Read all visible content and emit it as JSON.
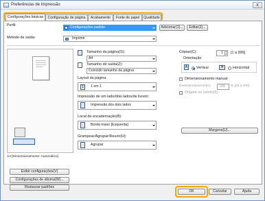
{
  "window": {
    "title": "Preferências de Impressão",
    "close_glyph": "x"
  },
  "tabs": [
    {
      "label": "Configurações básicas",
      "active": true
    },
    {
      "label": "Configuração de página",
      "active": false
    },
    {
      "label": "Acabamento",
      "active": false
    },
    {
      "label": "Fonte de papel",
      "active": false
    },
    {
      "label": "Qualidade",
      "active": false
    }
  ],
  "profile": {
    "label": "Perfil:",
    "value": "Configurações padrão",
    "add_button": "Adicionar(1)...",
    "edit_button": "Editar(2)..."
  },
  "output_method": {
    "label": "Método de saída:",
    "value": "Imprimir"
  },
  "preview": {
    "caption": "A4 [Dimensionamento: Automático]"
  },
  "left_buttons": {
    "display_settings": "Exibir configurações(V)",
    "language_settings": "Configurações de idioma(W)...",
    "restore_defaults": "Restaurar padrões"
  },
  "page_size": {
    "label": "Tamanho da página(S):",
    "value": "A4"
  },
  "output_size": {
    "label": "Tamanho de saída(Z):",
    "value": "Coincidir tamanho da página"
  },
  "layout": {
    "label": "Layout da página:",
    "value": "1 em 1"
  },
  "duplex": {
    "label": "Impressão de um lado/dois lados/de livreto:",
    "value": "Impressão dos dois lados"
  },
  "binding": {
    "label": "Local de encadernação(B):",
    "value": "Borda maior [Esquerda]"
  },
  "staple": {
    "label": "Grampear/Agrupar/Reunir(H):",
    "value": "Agrupar"
  },
  "copies": {
    "label": "Cópias(C):",
    "value": "1",
    "range": "[1 a 999]"
  },
  "orientation": {
    "label": "Orientação",
    "portrait": "Vertical",
    "landscape": "Horizontal",
    "selected": "portrait"
  },
  "manual_scaling": {
    "label": "Dimensionamento manual",
    "scale_label": "Dimensionamento(E):",
    "scale_value": "100",
    "scale_range": "% [25 a 200]"
  },
  "center_origin": {
    "label": "Origem no centro(5)"
  },
  "margin_button": "Margens(U)...",
  "dialog_buttons": {
    "ok": "OK",
    "cancel": "Cancelar",
    "help": "Ajuda"
  },
  "colors": {
    "highlight": "#f5a400",
    "selection": "#3399ff"
  }
}
